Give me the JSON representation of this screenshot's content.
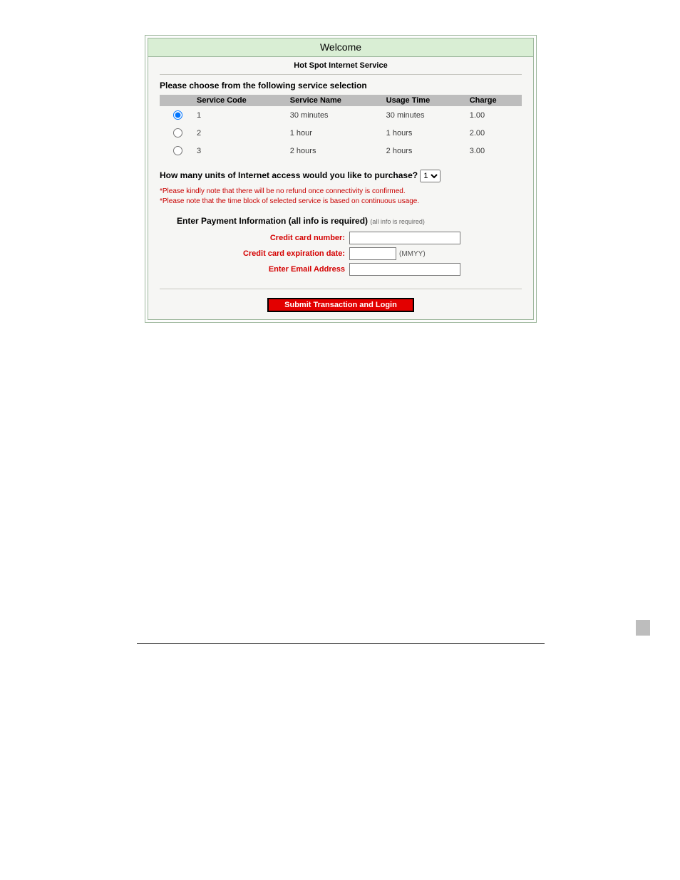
{
  "panel": {
    "welcome": "Welcome",
    "subtitle": "Hot Spot Internet Service",
    "choose_heading": "Please choose from the following service selection",
    "table": {
      "headers": {
        "radio": "",
        "code": "Service Code",
        "name": "Service Name",
        "usage": "Usage Time",
        "charge": "Charge"
      },
      "rows": [
        {
          "selected": true,
          "code": "1",
          "name": "30 minutes",
          "usage": "30 minutes",
          "charge": "1.00"
        },
        {
          "selected": false,
          "code": "2",
          "name": "1 hour",
          "usage": "1 hours",
          "charge": "2.00"
        },
        {
          "selected": false,
          "code": "3",
          "name": "2 hours",
          "usage": "2 hours",
          "charge": "3.00"
        }
      ]
    },
    "units_question": "How many units of Internet access would you like to purchase?",
    "units_value": "1",
    "note1": "*Please kindly note that there will be no refund once connectivity is confirmed.",
    "note2": "*Please note that the time block of selected service is based on continuous usage.",
    "pay_heading": "Enter Payment Information (all info is required)",
    "pay_heading_small": "(all info is required)",
    "labels": {
      "cc_number": "Credit card number:",
      "cc_exp": "Credit card expiration date:",
      "email": "Enter Email Address"
    },
    "mmyy_hint": "(MMYY)",
    "submit_label": "Submit Transaction and Login"
  }
}
